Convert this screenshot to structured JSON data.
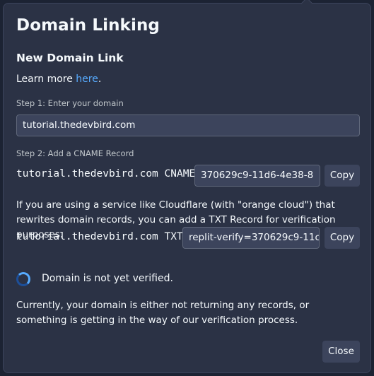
{
  "modal": {
    "title": "Domain Linking",
    "subtitle": "New Domain Link",
    "learn_more_prefix": "Learn more ",
    "learn_more_link": "here",
    "learn_more_suffix": "."
  },
  "step1": {
    "label": "Step 1: Enter your domain",
    "domain_value": "tutorial.thedevbird.com"
  },
  "step2": {
    "label": "Step 2: Add a CNAME Record",
    "cname_record": "tutorial.thedevbird.com CNAME",
    "cname_value": "370629c9-11d6-4e38-8",
    "copy_label": "Copy"
  },
  "txt": {
    "explanation": "If you are using a service like Cloudflare (with \"orange cloud\") that rewrites domain records, you can add a TXT Record for verification purposes.",
    "txt_record": "tutorial.thedevbird.com TXT",
    "txt_value": "replit-verify=370629c9-11c",
    "copy_label": "Copy"
  },
  "status": {
    "text": "Domain is not yet verified.",
    "detail": "Currently, your domain is either not returning any records, or something is getting in the way of our verification process."
  },
  "footer": {
    "close_label": "Close"
  },
  "colors": {
    "background": "#1c2333",
    "panel": "#2b3245",
    "link": "#57abff",
    "spinner": "#57abff"
  }
}
